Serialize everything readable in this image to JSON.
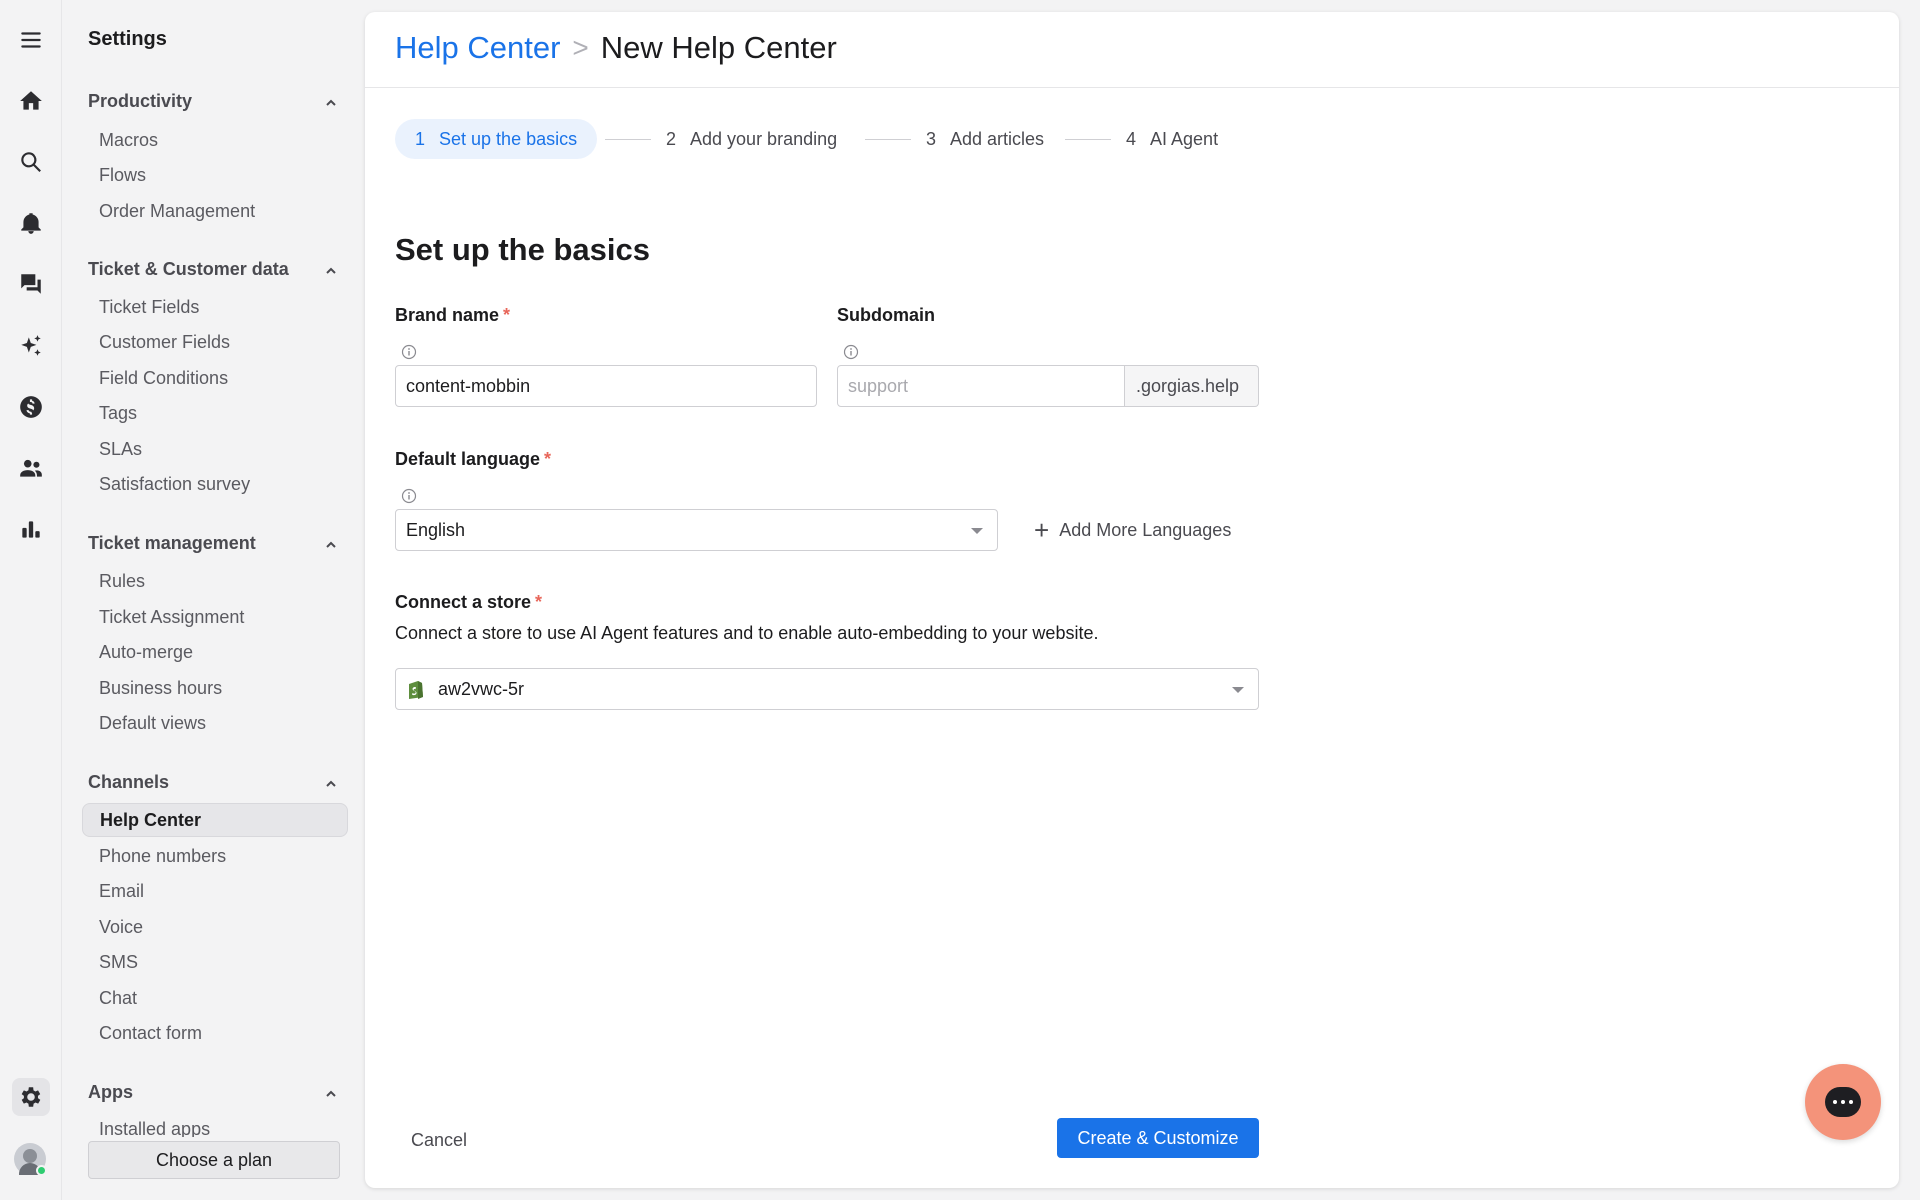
{
  "rail": {
    "icons": [
      "menu-icon",
      "home-icon",
      "search-icon",
      "bell-icon",
      "chat-icon",
      "sparkle-icon",
      "dollar-icon",
      "users-icon",
      "bar-chart-icon",
      "gear-icon"
    ]
  },
  "sidebar": {
    "title": "Settings",
    "sections": [
      {
        "title": "Productivity",
        "items": [
          "Macros",
          "Flows",
          "Order Management"
        ]
      },
      {
        "title": "Ticket & Customer data",
        "items": [
          "Ticket Fields",
          "Customer Fields",
          "Field Conditions",
          "Tags",
          "SLAs",
          "Satisfaction survey"
        ]
      },
      {
        "title": "Ticket management",
        "items": [
          "Rules",
          "Ticket Assignment",
          "Auto-merge",
          "Business hours",
          "Default views"
        ]
      },
      {
        "title": "Channels",
        "items": [
          "Help Center",
          "Phone numbers",
          "Email",
          "Voice",
          "SMS",
          "Chat",
          "Contact form"
        ]
      },
      {
        "title": "Apps",
        "items": [
          "Installed apps"
        ]
      }
    ],
    "active_item": "Help Center",
    "plan_button": "Choose a plan"
  },
  "header": {
    "breadcrumb_link": "Help Center",
    "breadcrumb_sep": ">",
    "breadcrumb_current": "New Help Center"
  },
  "stepper": {
    "steps": [
      {
        "num": "1",
        "label": "Set up the basics",
        "active": true
      },
      {
        "num": "2",
        "label": "Add your branding",
        "active": false
      },
      {
        "num": "3",
        "label": "Add articles",
        "active": false
      },
      {
        "num": "4",
        "label": "AI Agent",
        "active": false
      }
    ]
  },
  "form": {
    "title": "Set up the basics",
    "brand_label": "Brand name",
    "required_mark": "*",
    "brand_value": "content-mobbin",
    "subdomain_label": "Subdomain",
    "subdomain_placeholder": "support",
    "subdomain_suffix": ".gorgias.help",
    "language_label": "Default language",
    "language_value": "English",
    "add_languages": "Add More Languages",
    "store_label": "Connect a store",
    "store_description": "Connect a store to use AI Agent features and to enable auto-embedding to your website.",
    "store_value": "aw2vwc-5r"
  },
  "footer": {
    "cancel": "Cancel",
    "create": "Create & Customize"
  },
  "colors": {
    "accent": "#1a73e8",
    "required": "#e8665a",
    "chat_fab": "#f4937a",
    "shopify": "#5e8e3e"
  }
}
